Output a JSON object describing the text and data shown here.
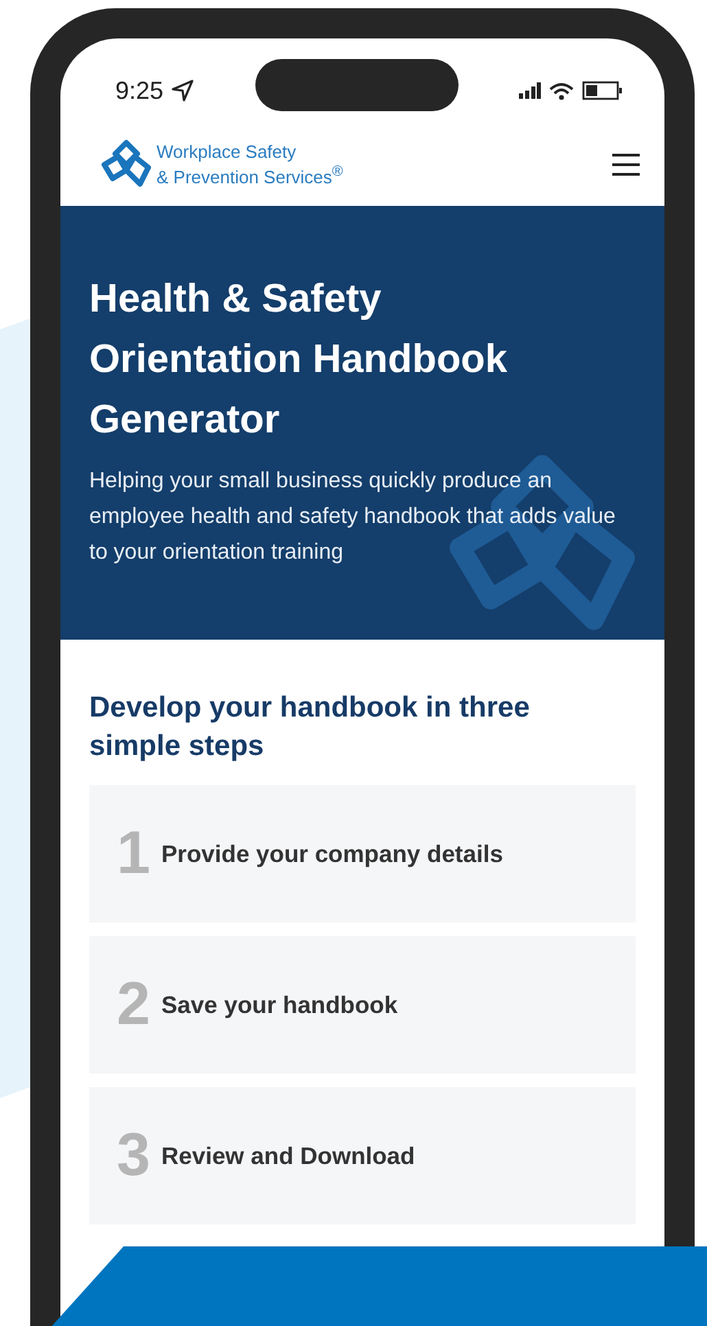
{
  "status_bar": {
    "time": "9:25"
  },
  "header": {
    "logo_lines": [
      "Workplace Safety",
      "& Prevention Services$^{®}$"
    ]
  },
  "hero": {
    "title": "Health & Safety Orientation Handbook Generator",
    "subtitle": "Helping your small business quickly produce an employee health and safety handbook that adds value to your orientation training"
  },
  "steps_section": {
    "heading": "Develop your handbook in three simple steps",
    "steps": [
      {
        "number": "1",
        "label": "Provide your company details"
      },
      {
        "number": "2",
        "label": "Save your handbook"
      },
      {
        "number": "3",
        "label": "Review and Download"
      }
    ]
  }
}
